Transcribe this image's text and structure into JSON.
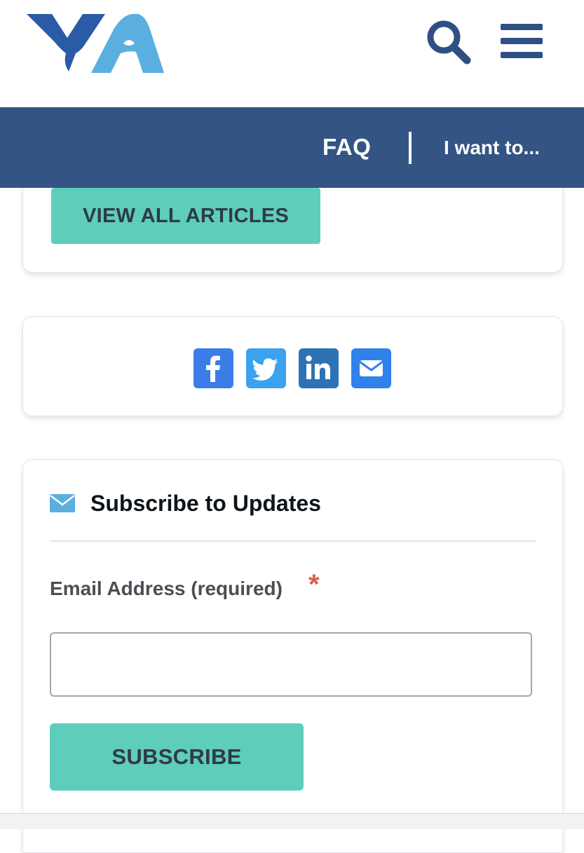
{
  "header": {
    "logo_name": "yfa-logo",
    "search_icon": "search-icon",
    "menu_icon": "hamburger-menu-icon"
  },
  "nav": {
    "faq": "FAQ",
    "i_want_to": "I want to..."
  },
  "articles": {
    "view_all_label": "VIEW ALL ARTICLES"
  },
  "share": {
    "icons": [
      "facebook-icon",
      "twitter-icon",
      "linkedin-icon",
      "email-icon"
    ]
  },
  "subscribe": {
    "title": "Subscribe to Updates",
    "email_label": "Email Address (required)",
    "required_marker": "*",
    "email_value": "",
    "button_label": "SUBSCRIBE"
  },
  "colors": {
    "brand_dark_blue": "#2f5083",
    "nav_bar": "#345484",
    "logo_light_blue": "#5aafe0",
    "teal_button": "#5ecdbb",
    "required_red": "#de5f45"
  }
}
